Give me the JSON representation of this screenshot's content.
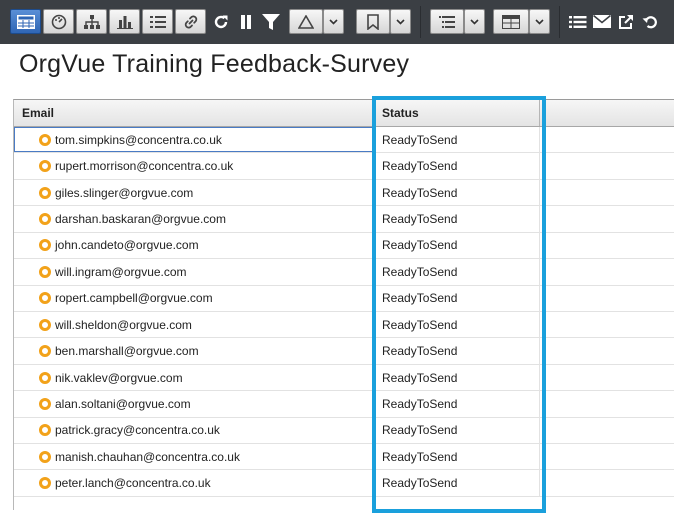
{
  "toolbar": {
    "icons": [
      "table-view-icon",
      "dashboard-icon",
      "org-chart-icon",
      "bar-chart-icon",
      "list-icon",
      "link-icon",
      "refresh-icon",
      "pause-icon",
      "filter-icon",
      "triangle-icon",
      "dropdown-icon",
      "bookmark-icon",
      "dropdown-icon",
      "indent-list-icon",
      "dropdown-icon",
      "grid-table-icon",
      "dropdown-icon",
      "list-lines-icon",
      "mail-icon",
      "external-link-icon",
      "undo-icon"
    ],
    "colors": {
      "background": "#3b3f44",
      "active": "#3a75c4"
    }
  },
  "page": {
    "title": "OrgVue Training Feedback-Survey"
  },
  "grid": {
    "columns": {
      "email": "Email",
      "status": "Status"
    },
    "status_color": "#f2a21a",
    "highlight_color": "#1aa0dc",
    "rows": [
      {
        "email": "tom.simpkins@concentra.co.uk",
        "status": "ReadyToSend"
      },
      {
        "email": "rupert.morrison@concentra.co.uk",
        "status": "ReadyToSend"
      },
      {
        "email": "giles.slinger@orgvue.com",
        "status": "ReadyToSend"
      },
      {
        "email": "darshan.baskaran@orgvue.com",
        "status": "ReadyToSend"
      },
      {
        "email": "john.candeto@orgvue.com",
        "status": "ReadyToSend"
      },
      {
        "email": "will.ingram@orgvue.com",
        "status": "ReadyToSend"
      },
      {
        "email": "ropert.campbell@orgvue.com",
        "status": "ReadyToSend"
      },
      {
        "email": "will.sheldon@orgvue.com",
        "status": "ReadyToSend"
      },
      {
        "email": "ben.marshall@orgvue.com",
        "status": "ReadyToSend"
      },
      {
        "email": "nik.vaklev@orgvue.com",
        "status": "ReadyToSend"
      },
      {
        "email": "alan.soltani@orgvue.com",
        "status": "ReadyToSend"
      },
      {
        "email": "patrick.gracy@concentra.co.uk",
        "status": "ReadyToSend"
      },
      {
        "email": "manish.chauhan@concentra.co.uk",
        "status": "ReadyToSend"
      },
      {
        "email": "peter.lanch@concentra.co.uk",
        "status": "ReadyToSend"
      }
    ]
  }
}
